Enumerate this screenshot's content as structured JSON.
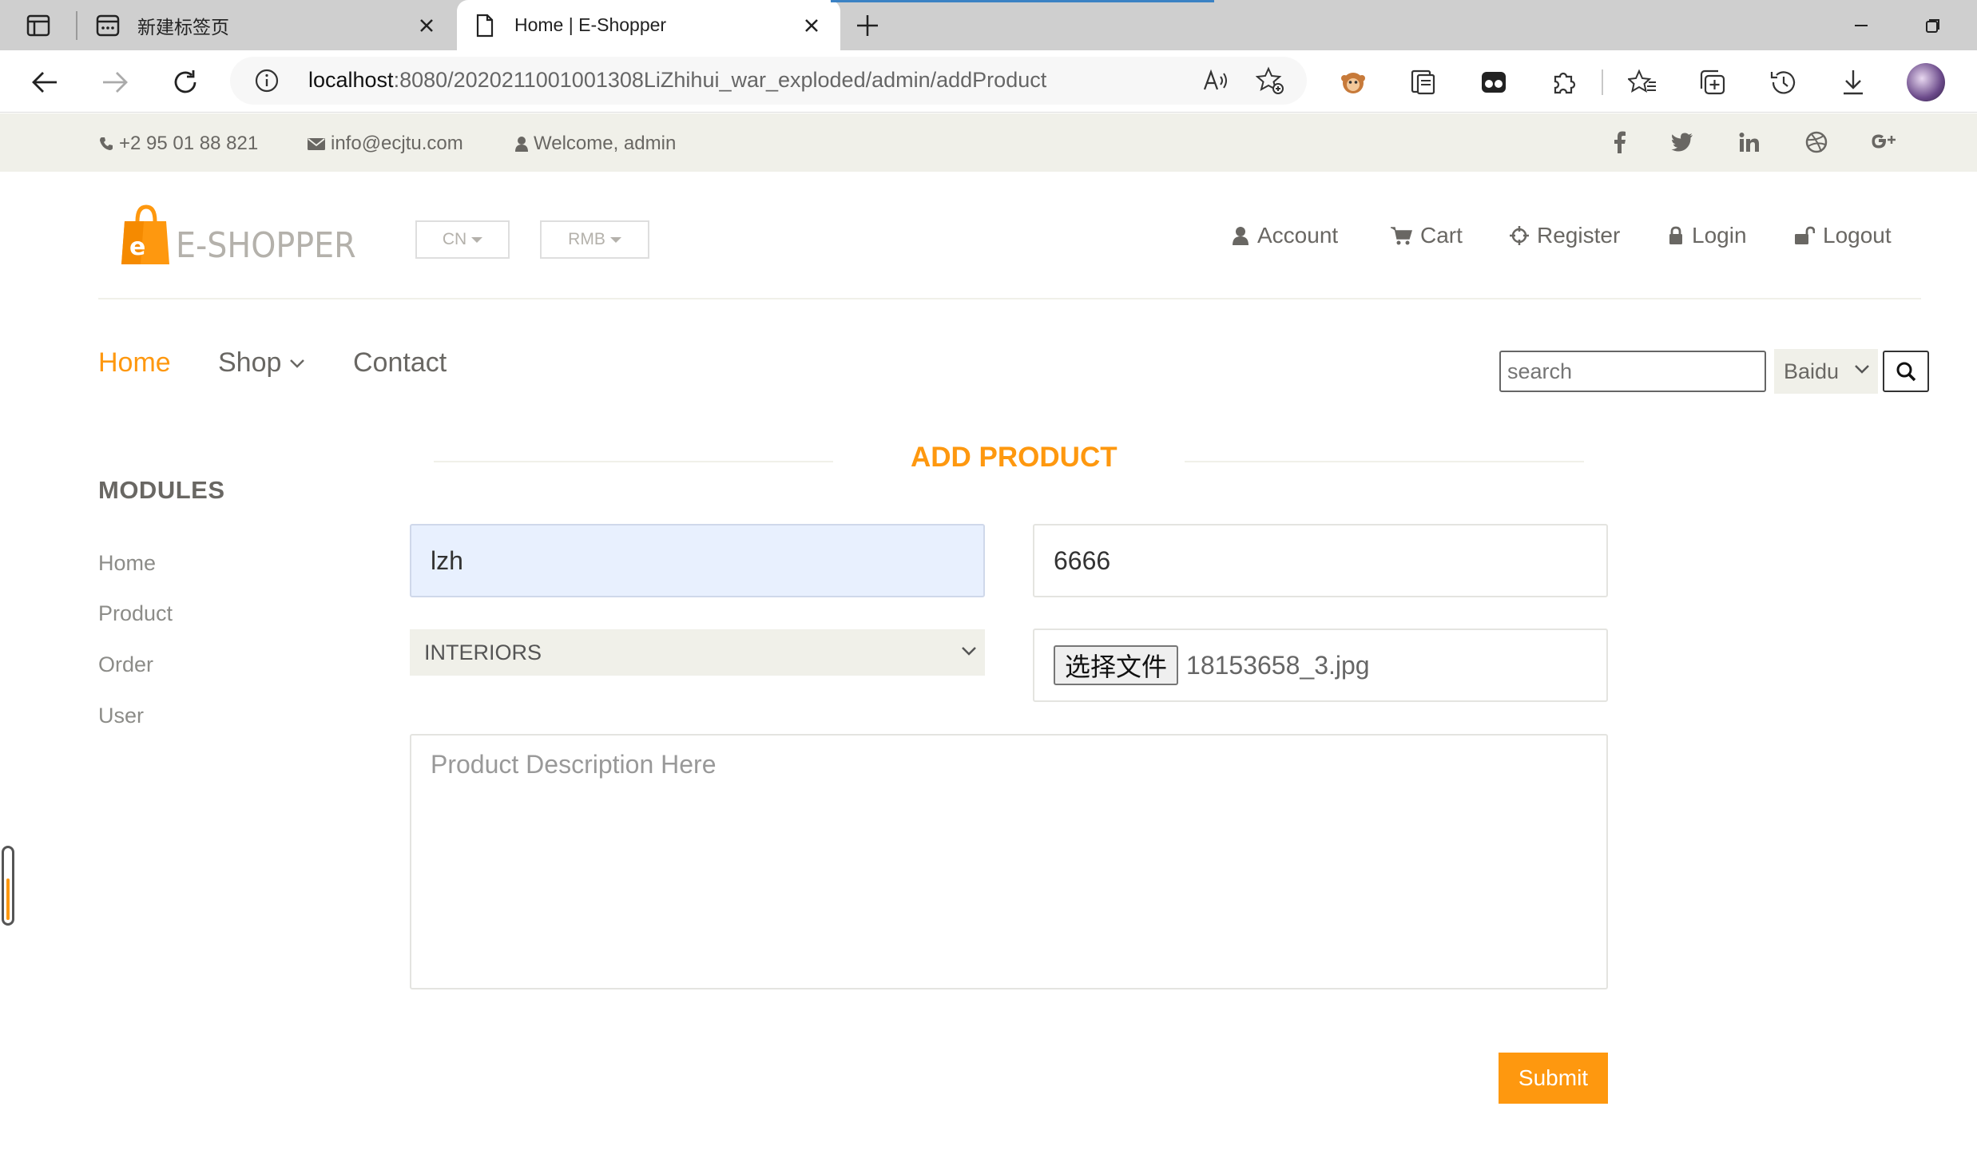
{
  "browser": {
    "tabs": [
      {
        "title": "新建标签页",
        "active": false
      },
      {
        "title": "Home | E-Shopper",
        "active": true
      }
    ],
    "url_host": "localhost",
    "url_path": ":8080/202021100100​1308LiZhihui_war_exploded/admin/addProduct"
  },
  "topbar": {
    "phone": "+2 95 01 88 821",
    "email": "info@ecjtu.com",
    "welcome": "Welcome, admin",
    "social_icons": [
      "facebook-icon",
      "twitter-icon",
      "linkedin-icon",
      "dribbble-icon",
      "google-plus-icon"
    ]
  },
  "header": {
    "logo_text": "E-SHOPPER",
    "language": "CN",
    "currency": "RMB",
    "account_links": [
      {
        "label": "Account",
        "icon": "user-icon"
      },
      {
        "label": "Cart",
        "icon": "cart-icon"
      },
      {
        "label": "Register",
        "icon": "crosshairs-icon"
      },
      {
        "label": "Login",
        "icon": "lock-icon"
      },
      {
        "label": "Logout",
        "icon": "unlock-icon"
      }
    ]
  },
  "mainnav": {
    "items": [
      {
        "label": "Home",
        "active": true
      },
      {
        "label": "Shop",
        "dropdown": true
      },
      {
        "label": "Contact"
      }
    ],
    "search_placeholder": "search",
    "search_engine": "Baidu"
  },
  "sidebar": {
    "title": "MODULES",
    "items": [
      "Home",
      "Product",
      "Order",
      "User"
    ]
  },
  "form": {
    "title": "ADD PRODUCT",
    "name_value": "lzh",
    "price_value": "6666",
    "category_value": "INTERIORS",
    "file_button": "选择文件",
    "file_name": "18153658_3.jpg",
    "description_placeholder": "Product Description Here",
    "submit_label": "Submit"
  },
  "colors": {
    "accent": "#fe980f",
    "muted_bg": "#f0f0e9",
    "text": "#696763"
  }
}
